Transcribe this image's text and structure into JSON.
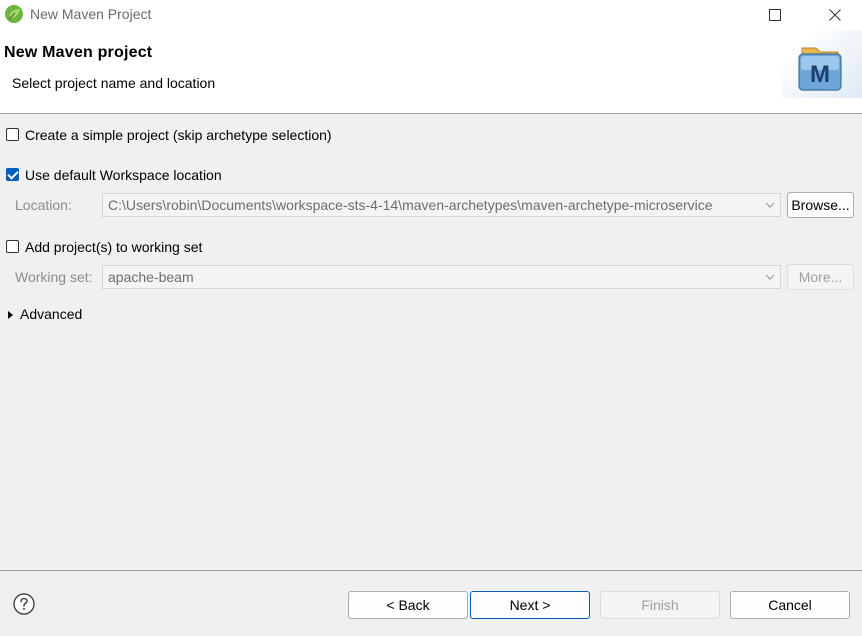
{
  "window": {
    "title": "New Maven Project"
  },
  "header": {
    "title": "New Maven project",
    "subtitle": "Select project name and location",
    "logo_letter": "M"
  },
  "options": {
    "simple_project": {
      "label": "Create a simple project (skip archetype selection)",
      "checked": false
    },
    "default_location": {
      "label": "Use default Workspace location",
      "checked": true
    },
    "location_label": "Location:",
    "location_value": "C:\\Users\\robin\\Documents\\workspace-sts-4-14\\maven-archetypes\\maven-archetype-microservice",
    "browse_label": "Browse...",
    "working_set_toggle": {
      "label": "Add project(s) to working set",
      "checked": false
    },
    "working_set_label": "Working set:",
    "working_set_value": "apache-beam",
    "more_label": "More...",
    "advanced_label": "Advanced"
  },
  "footer": {
    "back_label": "< Back",
    "next_label": "Next >",
    "finish_label": "Finish",
    "cancel_label": "Cancel"
  },
  "colors": {
    "accent": "#005fb8",
    "separator": "#a0a0a0",
    "dialog_bg": "#f0f0f0"
  }
}
